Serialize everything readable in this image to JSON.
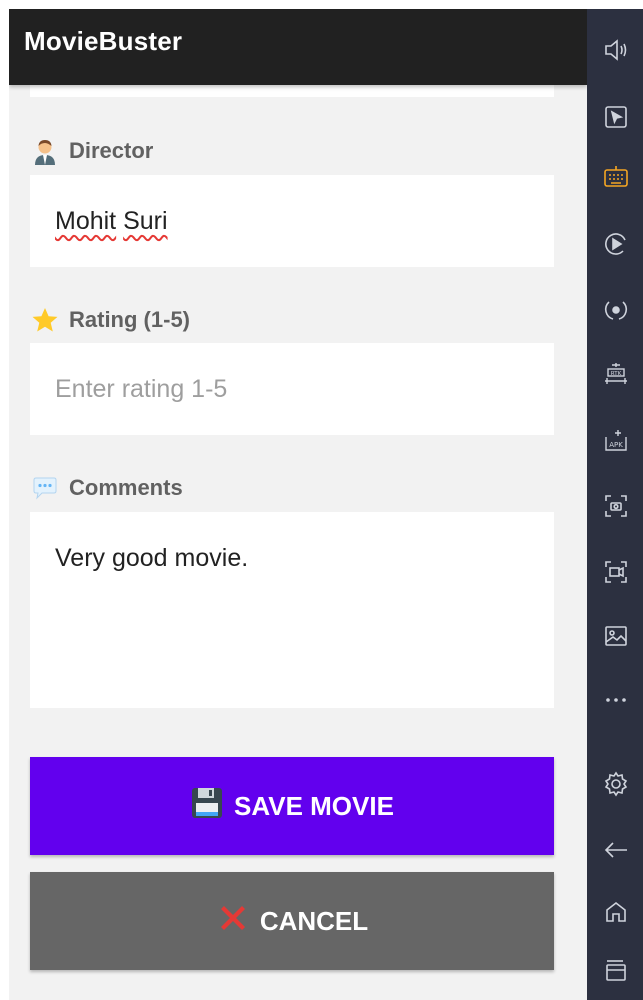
{
  "app": {
    "title": "MovieBuster"
  },
  "form": {
    "director": {
      "label": "Director",
      "icon": "man-office-worker-icon",
      "value_first": "Mohit",
      "value_second": "Suri"
    },
    "rating": {
      "label": "Rating (1-5)",
      "icon": "star-icon",
      "value": "",
      "placeholder": "Enter rating 1-5"
    },
    "comments": {
      "label": "Comments",
      "icon": "speech-balloon-icon",
      "value": "Very good movie."
    }
  },
  "buttons": {
    "save_label": "SAVE MOVIE",
    "save_icon": "floppy-disk-icon",
    "cancel_label": "CANCEL",
    "cancel_icon": "cross-mark-icon"
  },
  "colors": {
    "app_bar": "#212121",
    "save_button": "#6200ee",
    "cancel_button": "#666666",
    "background": "#f2f2f2",
    "emulator_sidebar": "#2c3040",
    "keyboard_icon_accent": "#f5a623"
  },
  "emulator_toolbar": {
    "icons": [
      "volume-icon",
      "pointer-icon",
      "keyboard-icon",
      "play-record-icon",
      "rotate-icon",
      "apk-install-icon",
      "apk-icon",
      "screenshot-icon",
      "screen-record-icon",
      "gallery-icon",
      "more-icon",
      "settings-icon",
      "back-icon",
      "home-icon",
      "recent-apps-icon"
    ]
  }
}
